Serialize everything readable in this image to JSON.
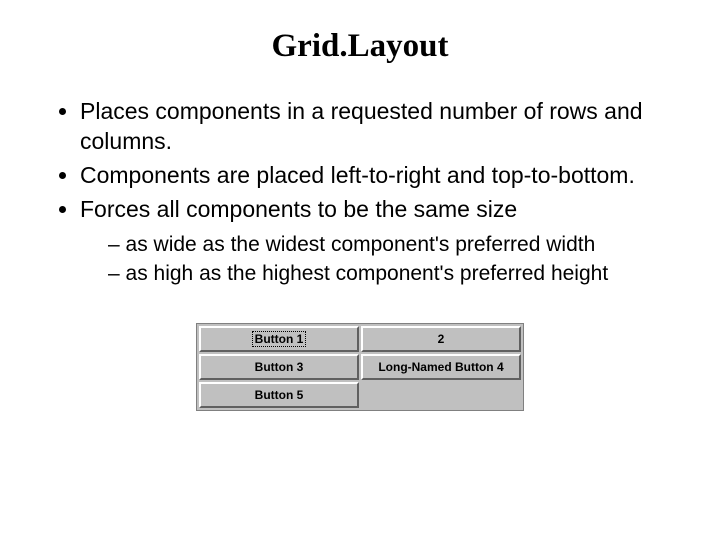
{
  "title": "Grid.Layout",
  "bullets": [
    "Places components in a requested number of rows and columns.",
    "Components are placed left-to-right and top-to-bottom.",
    "Forces all components to be the same size"
  ],
  "subbullets": [
    "as wide as the widest component's preferred width",
    "as high as the highest component's preferred height"
  ],
  "buttons": {
    "b1": "Button 1",
    "b2": "2",
    "b3": "Button 3",
    "b4": "Long-Named Button 4",
    "b5": "Button 5"
  }
}
